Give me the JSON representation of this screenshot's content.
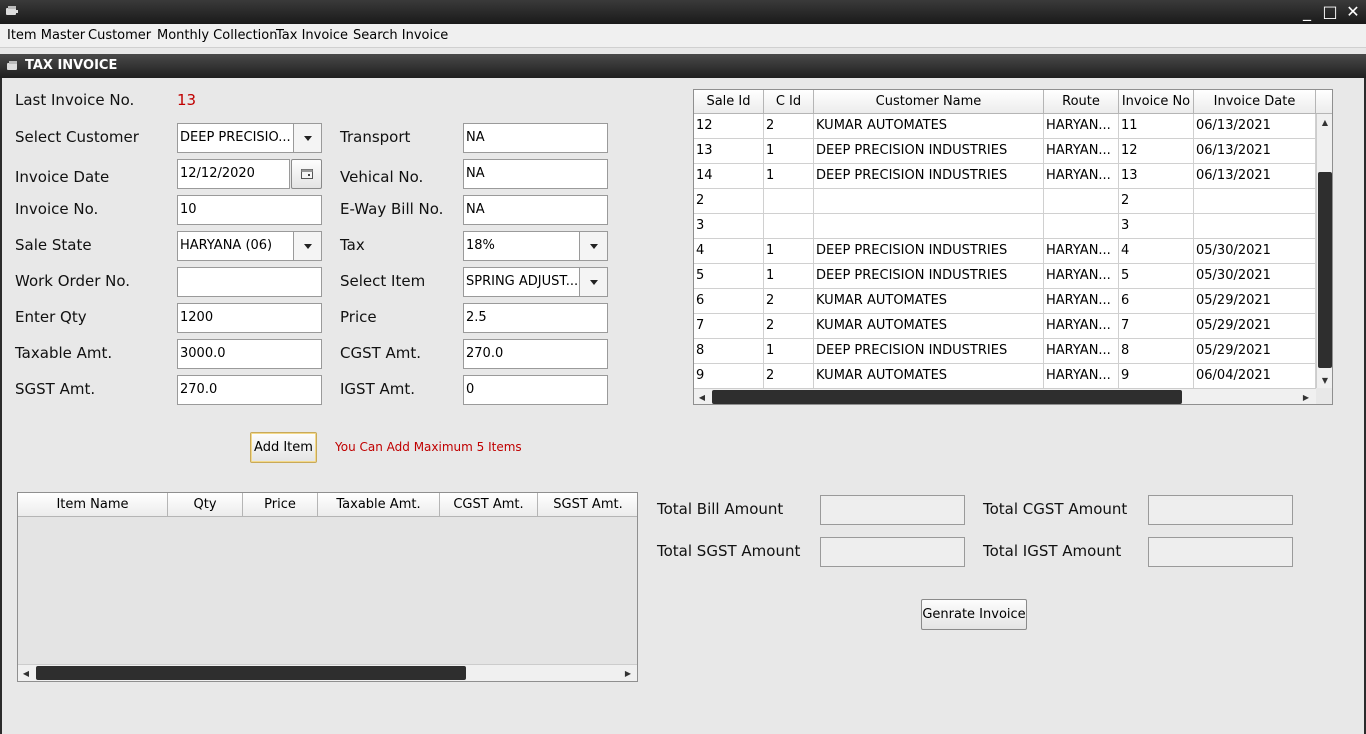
{
  "window": {
    "controls": [
      "_",
      "□",
      "✕"
    ]
  },
  "menu": [
    "Item Master",
    "Customer",
    "Monthly Collection",
    "Tax Invoice",
    "Search Invoice"
  ],
  "frame_title": "TAX INVOICE",
  "form": {
    "last_invoice_label": "Last Invoice No.",
    "last_invoice_value": "13",
    "select_customer_label": "Select Customer",
    "select_customer_value": "DEEP PRECISIO...",
    "transport_label": "Transport",
    "transport_value": "NA",
    "invoice_date_label": "Invoice Date",
    "invoice_date_value": "12/12/2020",
    "vehical_label": "Vehical No.",
    "vehical_value": "NA",
    "invoice_no_label": "Invoice No.",
    "invoice_no_value": "10",
    "eway_label": "E-Way Bill No.",
    "eway_value": "NA",
    "sale_state_label": "Sale State",
    "sale_state_value": "HARYANA (06)",
    "tax_label": "Tax",
    "tax_value": "18%",
    "work_order_label": "Work Order No.",
    "work_order_value": "",
    "select_item_label": "Select Item",
    "select_item_value": "SPRING ADJUST...",
    "enter_qty_label": "Enter Qty",
    "enter_qty_value": "1200",
    "price_label": "Price",
    "price_value": "2.5",
    "taxable_label": "Taxable Amt.",
    "taxable_value": "3000.0",
    "cgst_label": "CGST Amt.",
    "cgst_value": "270.0",
    "sgst_label": "SGST Amt.",
    "sgst_value": "270.0",
    "igst_label": "IGST Amt.",
    "igst_value": "0",
    "add_item_label": "Add Item",
    "max_items_note": "You Can Add Maximum 5 Items",
    "note_color": "#c00000"
  },
  "invoice_table": {
    "columns": [
      "Sale Id",
      "C Id",
      "Customer Name",
      "Route",
      "Invoice No",
      "Invoice Date"
    ],
    "rows": [
      [
        "12",
        "2",
        "KUMAR AUTOMATES",
        "HARYAN...",
        "11",
        "06/13/2021"
      ],
      [
        "13",
        "1",
        "DEEP PRECISION INDUSTRIES",
        "HARYAN...",
        "12",
        "06/13/2021"
      ],
      [
        "14",
        "1",
        "DEEP PRECISION INDUSTRIES",
        "HARYAN...",
        "13",
        "06/13/2021"
      ],
      [
        "2",
        "",
        "",
        "",
        "2",
        ""
      ],
      [
        "3",
        "",
        "",
        "",
        "3",
        ""
      ],
      [
        "4",
        "1",
        "DEEP PRECISION INDUSTRIES",
        "HARYAN...",
        "4",
        "05/30/2021"
      ],
      [
        "5",
        "1",
        "DEEP PRECISION INDUSTRIES",
        "HARYAN...",
        "5",
        "05/30/2021"
      ],
      [
        "6",
        "2",
        "KUMAR AUTOMATES",
        "HARYAN...",
        "6",
        "05/29/2021"
      ],
      [
        "7",
        "2",
        "KUMAR AUTOMATES",
        "HARYAN...",
        "7",
        "05/29/2021"
      ],
      [
        "8",
        "1",
        "DEEP PRECISION INDUSTRIES",
        "HARYAN...",
        "8",
        "05/29/2021"
      ],
      [
        "9",
        "2",
        "KUMAR AUTOMATES",
        "HARYAN...",
        "9",
        "06/04/2021"
      ]
    ]
  },
  "items_table": {
    "columns": [
      "Item Name",
      "Qty",
      "Price",
      "Taxable Amt.",
      "CGST Amt.",
      "SGST Amt."
    ]
  },
  "totals": {
    "bill_label": "Total Bill Amount",
    "cgst_label": "Total CGST Amount",
    "sgst_label": "Total SGST Amount",
    "igst_label": "Total IGST Amount",
    "bill_value": "",
    "cgst_value": "",
    "sgst_value": "",
    "igst_value": ""
  },
  "generate_label": "Genrate Invoice"
}
